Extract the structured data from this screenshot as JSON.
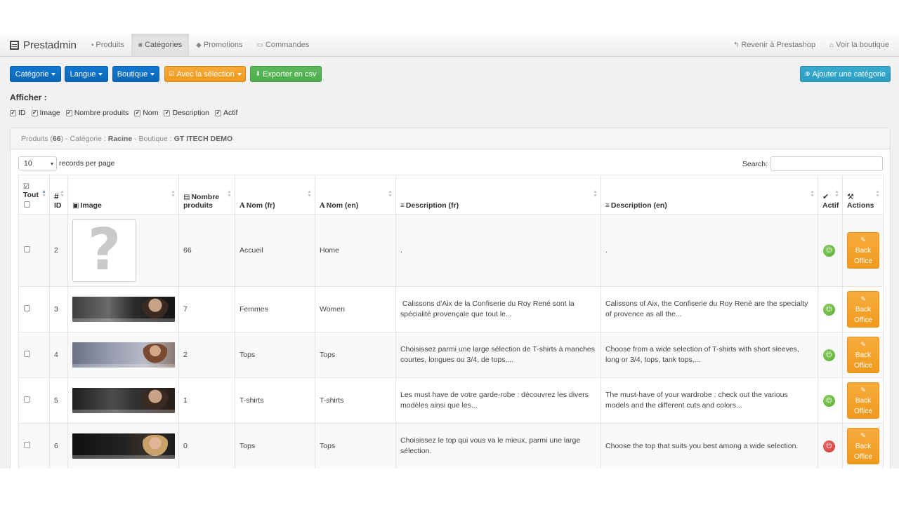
{
  "navbar": {
    "brand": "Prestadmin",
    "items": [
      {
        "icon": "book-icon",
        "glyph": "▪",
        "label": "Produits",
        "active": false
      },
      {
        "icon": "folder-icon",
        "glyph": "■",
        "label": "Catégories",
        "active": true
      },
      {
        "icon": "tag-icon",
        "glyph": "◆",
        "label": "Promotions",
        "active": false
      },
      {
        "icon": "credit-card-icon",
        "glyph": "▭",
        "label": "Commandes",
        "active": false
      }
    ],
    "right_items": [
      {
        "icon": "reply-icon",
        "glyph": "↰",
        "label": "Revenir à Prestashop"
      },
      {
        "icon": "home-icon",
        "glyph": "⌂",
        "label": "Voir la boutique"
      }
    ]
  },
  "toolbar": {
    "categorie": "Catégorie",
    "langue": "Langue",
    "boutique": "Boutique",
    "selection": "Avec la sélection",
    "export": "Exporter en csv",
    "add": "Ajouter une catégorie"
  },
  "afficher": {
    "title": "Afficher :",
    "options": [
      "ID",
      "Image",
      "Nombre produits",
      "Nom",
      "Description",
      "Actif"
    ]
  },
  "panel": {
    "prefix": "Produits (",
    "count": "66",
    "mid1": ") - Catégorie : ",
    "category": "Racine",
    "mid2": " - Boutique : ",
    "shop": "GT ITECH DEMO"
  },
  "table_controls": {
    "page_size": "10",
    "records_label": "records per page",
    "search_label": "Search:"
  },
  "columns": {
    "all": "Tout",
    "id_hash": "#",
    "id": "ID",
    "image": "Image",
    "nb1": "Nombre",
    "nb2": "produits",
    "nom_fr": "Nom (fr)",
    "nom_en": "Nom (en)",
    "desc_fr": "Description (fr)",
    "desc_en": "Description (en)",
    "actif": "Actif",
    "actions": "Actions"
  },
  "action_label": [
    "Back",
    "Office"
  ],
  "rows": [
    {
      "id": "2",
      "image": "placeholder",
      "count": "66",
      "nom_fr": "Accueil",
      "nom_en": "Home",
      "desc_fr": ".",
      "desc_en": ".",
      "active": true
    },
    {
      "id": "3",
      "image": "banner-1",
      "count": "7",
      "nom_fr": "Femmes",
      "nom_en": "Women",
      "desc_fr": " Calissons d'Aix de la Confiserie du Roy René sont la spécialité provençale que tout le...",
      "desc_en": "Calissons of Aix, the Confiserie du Roy René are the specialty of provence as all the...",
      "active": true
    },
    {
      "id": "4",
      "image": "banner-2",
      "count": "2",
      "nom_fr": "Tops",
      "nom_en": "Tops",
      "desc_fr": "Choisissez parmi une large sélection de T-shirts à manches courtes, longues ou 3/4, de tops,...",
      "desc_en": "Choose from a wide selection of T-shirts with short sleeves, long or 3/4, tops, tank tops,...",
      "active": true
    },
    {
      "id": "5",
      "image": "banner-3",
      "count": "1",
      "nom_fr": "T-shirts",
      "nom_en": "T-shirts",
      "desc_fr": "Les must have de votre garde-robe : découvrez les divers modèles ainsi que les...",
      "desc_en": "The must-have of your wardrobe : check out the various models and the different cuts and colors...",
      "active": true
    },
    {
      "id": "6",
      "image": "banner-4",
      "count": "0",
      "nom_fr": "Tops",
      "nom_en": "Tops",
      "desc_fr": "Choisissez le top qui vous va le mieux, parmi une large sélection.",
      "desc_en": "Choose the top that suits you best among a wide selection.",
      "active": false
    }
  ],
  "colors": {
    "primary": "#0d66b6",
    "warning": "#f09a1c",
    "success": "#4cae4c",
    "info": "#2a9dc0",
    "active_on": "#52a82a",
    "active_off": "#c9302c"
  }
}
